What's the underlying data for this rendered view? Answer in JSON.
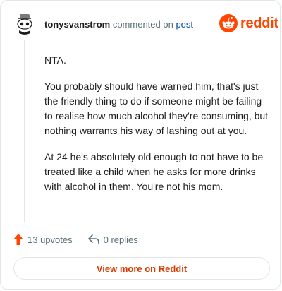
{
  "header": {
    "username": "tonysvanstrom",
    "action_text": "commented on",
    "post_link": "post",
    "brand": "reddit",
    "brand_color": "#ff4500"
  },
  "comment": {
    "paragraphs": [
      "NTA.",
      "You probably should have warned him, that's just the friendly thing to do if someone might be failing to realise how much alcohol they're consuming, but nothing warrants his way of lashing out at you.",
      "At 24 he's absolutely old enough to not have to be treated like a child when he asks for more drinks with alcohol in them. You're not his mom."
    ]
  },
  "actions": {
    "upvotes": "13 upvotes",
    "replies": "0 replies",
    "upvote_icon": "upvote-arrow-icon",
    "reply_icon": "reply-arrow-icon"
  },
  "footer": {
    "view_more": "View more on Reddit",
    "link_color": "#d93a00"
  }
}
